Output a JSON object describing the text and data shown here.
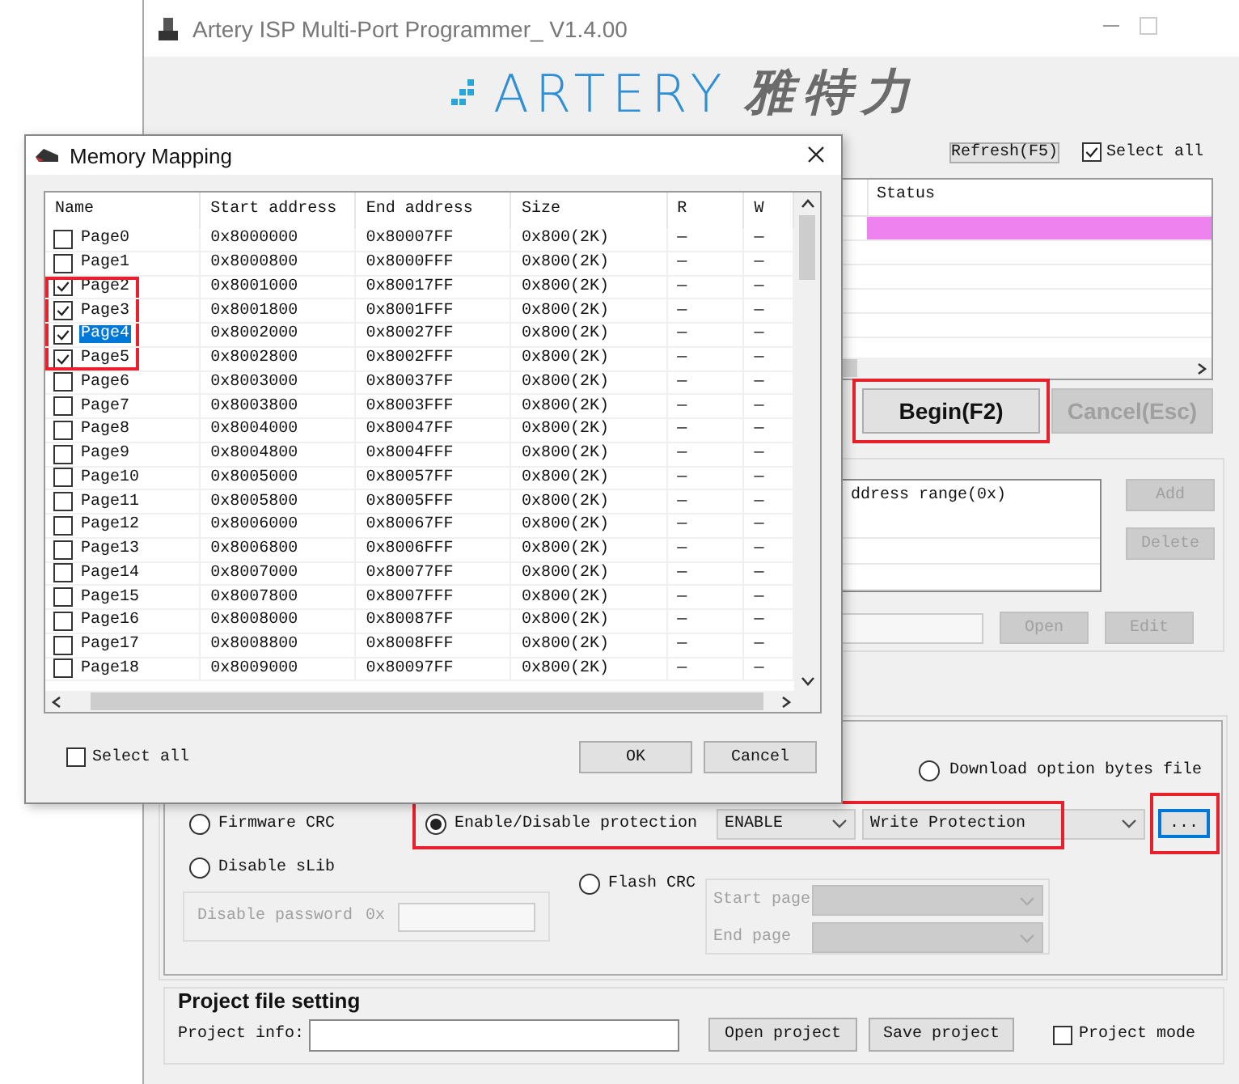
{
  "window": {
    "title": "Artery ISP Multi-Port Programmer_ V1.4.00"
  },
  "logo": {
    "wordmark": "ARTERY",
    "chinese": "雅特力"
  },
  "toolbar": {
    "refresh_button": "Refresh(F5)",
    "select_all": {
      "label": "Select all",
      "checked": true
    }
  },
  "device_table": {
    "columns": [
      "Status"
    ],
    "rows": [
      {
        "color": "#ee82ee"
      }
    ]
  },
  "actions": {
    "begin": {
      "label": "Begin(F2)",
      "disabled": false,
      "highlighted": true
    },
    "cancel": {
      "label": "Cancel(Esc)",
      "disabled": true
    }
  },
  "address_panel": {
    "list_header": "ddress range(0x)",
    "side_buttons": [
      {
        "label": "Add",
        "disabled": true
      },
      {
        "label": "Delete",
        "disabled": true
      }
    ],
    "file_buttons": [
      {
        "label": "Open",
        "disabled": true
      },
      {
        "label": "Edit",
        "disabled": true
      }
    ]
  },
  "options": {
    "download_option_bytes": {
      "label": "Download option bytes file",
      "selected": false
    },
    "firmware_crc": {
      "label": "Firmware CRC",
      "selected": false
    },
    "protection": {
      "label": "Enable/Disable protection",
      "selected": true,
      "highlighted": true,
      "mode": "ENABLE",
      "type": "Write Protection"
    },
    "browse_button": {
      "label": "...",
      "highlighted": true
    },
    "disable_slib": {
      "label": "Disable sLib",
      "selected": false
    },
    "password": {
      "label": "Disable password",
      "prefix": "0x"
    },
    "flash_crc": {
      "label": "Flash CRC",
      "selected": false
    },
    "start_page": {
      "label": "Start page"
    },
    "end_page": {
      "label": "End page"
    }
  },
  "project": {
    "title": "Project file setting",
    "info_label": "Project info:",
    "buttons": [
      "Open project",
      "Save project"
    ],
    "project_mode": {
      "label": "Project mode",
      "checked": false
    }
  },
  "dialog": {
    "title": "Memory Mapping",
    "columns": [
      "Name",
      "Start address",
      "End address",
      "Size",
      "R",
      "W"
    ],
    "rows": [
      {
        "name": "Page0",
        "start": "0x8000000",
        "end": "0x80007FF",
        "size": "0x800(2K)",
        "r": "—",
        "w": "—",
        "checked": false,
        "selected": false,
        "highlighted": false
      },
      {
        "name": "Page1",
        "start": "0x8000800",
        "end": "0x8000FFF",
        "size": "0x800(2K)",
        "r": "—",
        "w": "—",
        "checked": false,
        "selected": false,
        "highlighted": false
      },
      {
        "name": "Page2",
        "start": "0x8001000",
        "end": "0x80017FF",
        "size": "0x800(2K)",
        "r": "—",
        "w": "—",
        "checked": true,
        "selected": false,
        "highlighted": true
      },
      {
        "name": "Page3",
        "start": "0x8001800",
        "end": "0x8001FFF",
        "size": "0x800(2K)",
        "r": "—",
        "w": "—",
        "checked": true,
        "selected": false,
        "highlighted": true
      },
      {
        "name": "Page4",
        "start": "0x8002000",
        "end": "0x80027FF",
        "size": "0x800(2K)",
        "r": "—",
        "w": "—",
        "checked": true,
        "selected": true,
        "highlighted": true
      },
      {
        "name": "Page5",
        "start": "0x8002800",
        "end": "0x8002FFF",
        "size": "0x800(2K)",
        "r": "—",
        "w": "—",
        "checked": true,
        "selected": false,
        "highlighted": true
      },
      {
        "name": "Page6",
        "start": "0x8003000",
        "end": "0x80037FF",
        "size": "0x800(2K)",
        "r": "—",
        "w": "—",
        "checked": false,
        "selected": false,
        "highlighted": false
      },
      {
        "name": "Page7",
        "start": "0x8003800",
        "end": "0x8003FFF",
        "size": "0x800(2K)",
        "r": "—",
        "w": "—",
        "checked": false,
        "selected": false,
        "highlighted": false
      },
      {
        "name": "Page8",
        "start": "0x8004000",
        "end": "0x80047FF",
        "size": "0x800(2K)",
        "r": "—",
        "w": "—",
        "checked": false,
        "selected": false,
        "highlighted": false
      },
      {
        "name": "Page9",
        "start": "0x8004800",
        "end": "0x8004FFF",
        "size": "0x800(2K)",
        "r": "—",
        "w": "—",
        "checked": false,
        "selected": false,
        "highlighted": false
      },
      {
        "name": "Page10",
        "start": "0x8005000",
        "end": "0x80057FF",
        "size": "0x800(2K)",
        "r": "—",
        "w": "—",
        "checked": false,
        "selected": false,
        "highlighted": false
      },
      {
        "name": "Page11",
        "start": "0x8005800",
        "end": "0x8005FFF",
        "size": "0x800(2K)",
        "r": "—",
        "w": "—",
        "checked": false,
        "selected": false,
        "highlighted": false
      },
      {
        "name": "Page12",
        "start": "0x8006000",
        "end": "0x80067FF",
        "size": "0x800(2K)",
        "r": "—",
        "w": "—",
        "checked": false,
        "selected": false,
        "highlighted": false
      },
      {
        "name": "Page13",
        "start": "0x8006800",
        "end": "0x8006FFF",
        "size": "0x800(2K)",
        "r": "—",
        "w": "—",
        "checked": false,
        "selected": false,
        "highlighted": false
      },
      {
        "name": "Page14",
        "start": "0x8007000",
        "end": "0x80077FF",
        "size": "0x800(2K)",
        "r": "—",
        "w": "—",
        "checked": false,
        "selected": false,
        "highlighted": false
      },
      {
        "name": "Page15",
        "start": "0x8007800",
        "end": "0x8007FFF",
        "size": "0x800(2K)",
        "r": "—",
        "w": "—",
        "checked": false,
        "selected": false,
        "highlighted": false
      },
      {
        "name": "Page16",
        "start": "0x8008000",
        "end": "0x80087FF",
        "size": "0x800(2K)",
        "r": "—",
        "w": "—",
        "checked": false,
        "selected": false,
        "highlighted": false
      },
      {
        "name": "Page17",
        "start": "0x8008800",
        "end": "0x8008FFF",
        "size": "0x800(2K)",
        "r": "—",
        "w": "—",
        "checked": false,
        "selected": false,
        "highlighted": false
      },
      {
        "name": "Page18",
        "start": "0x8009000",
        "end": "0x80097FF",
        "size": "0x800(2K)",
        "r": "—",
        "w": "—",
        "checked": false,
        "selected": false,
        "highlighted": false
      }
    ],
    "select_all": {
      "label": "Select all",
      "checked": false
    },
    "buttons": [
      "OK",
      "Cancel"
    ]
  }
}
